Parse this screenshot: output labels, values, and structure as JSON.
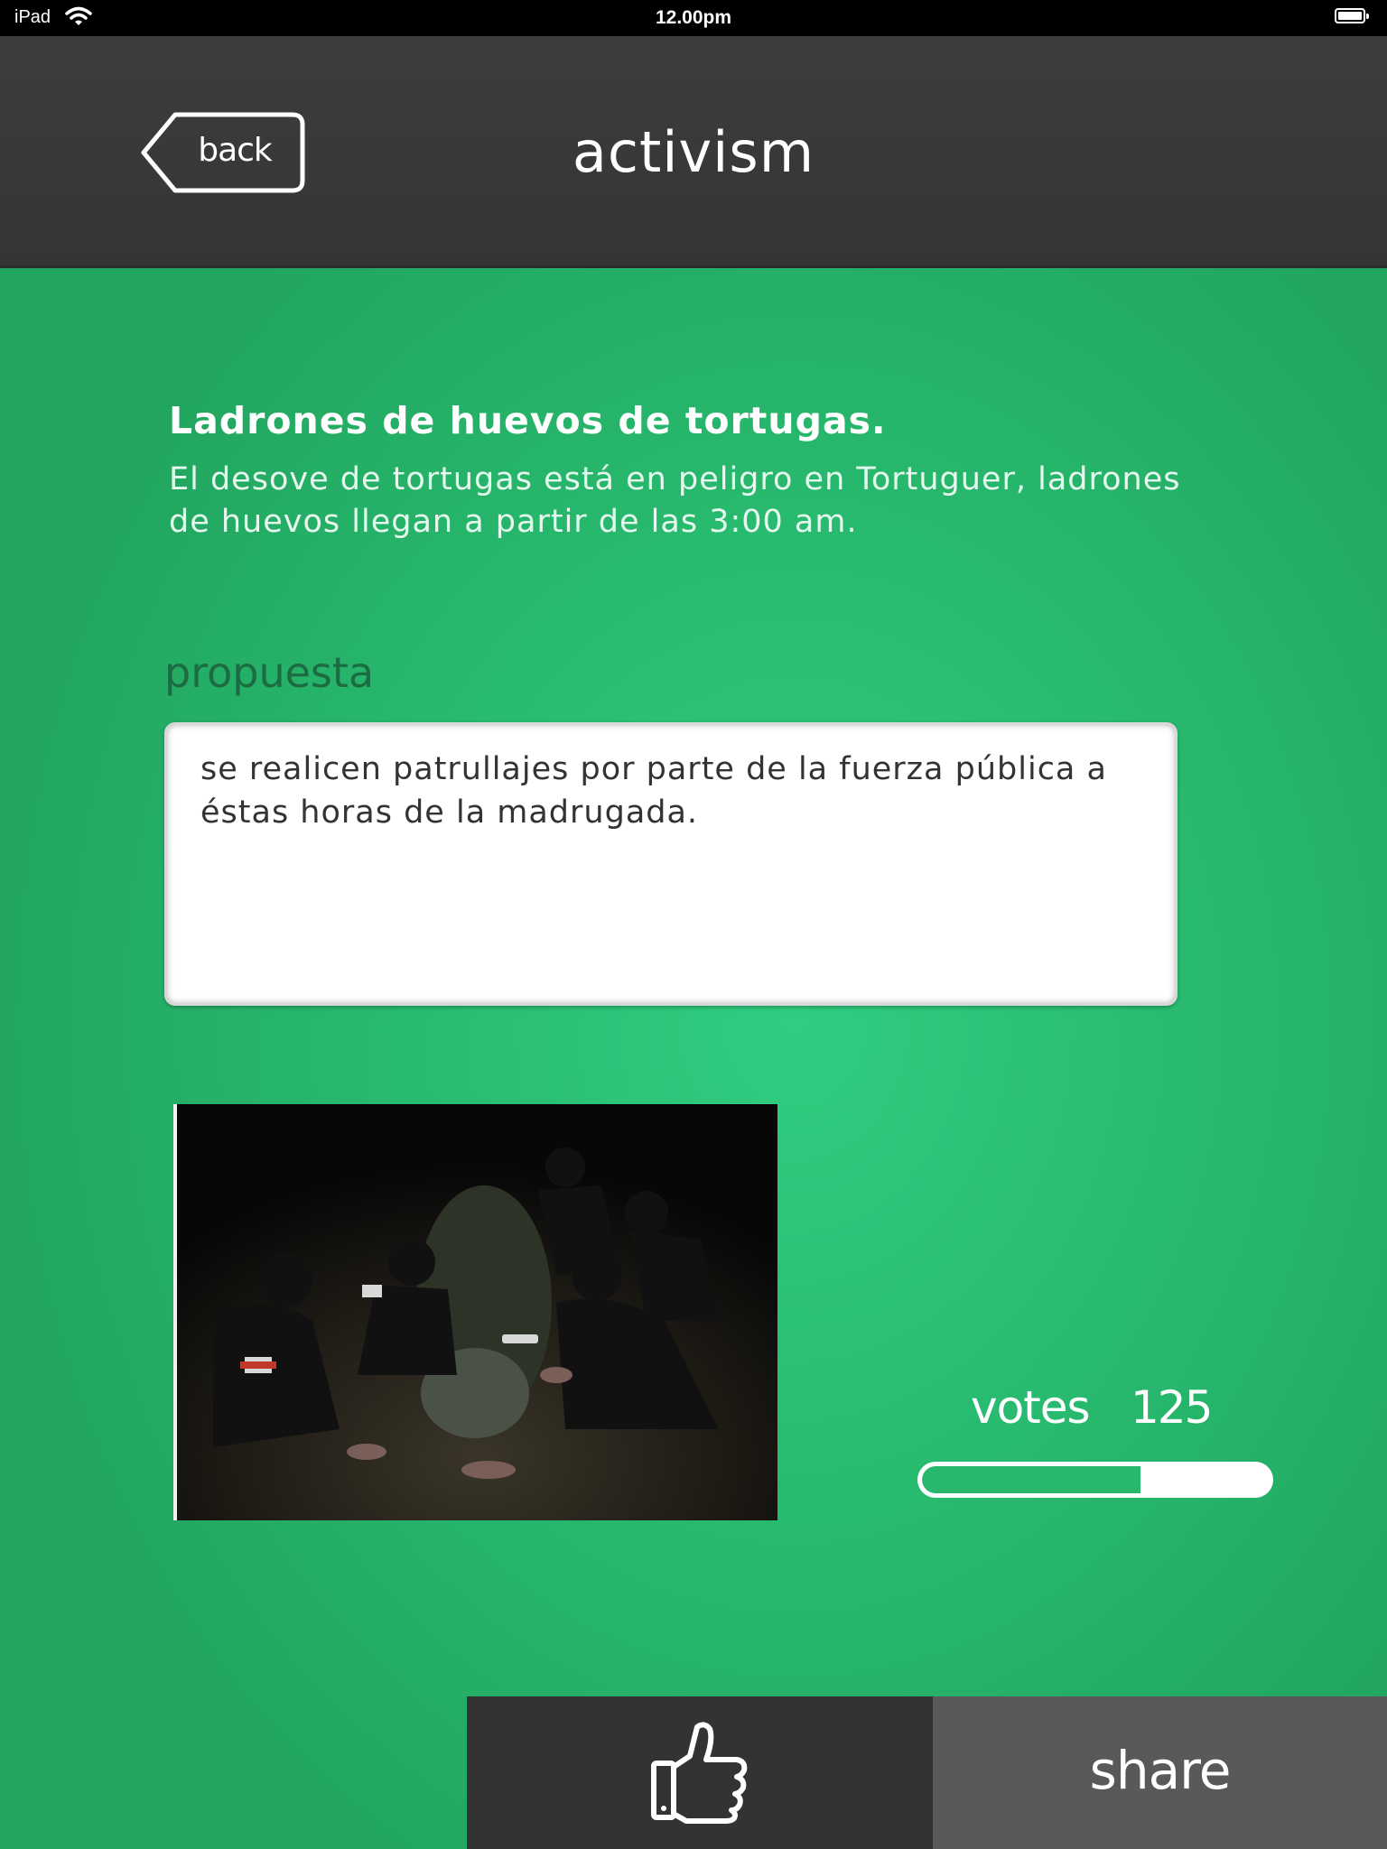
{
  "status_bar": {
    "device": "iPad",
    "time": "12.00pm"
  },
  "nav": {
    "back_label": "back",
    "title": "activism"
  },
  "issue": {
    "title": "Ladrones de huevos de tortugas.",
    "description": "El desove de tortugas está en peligro en Tortuguer, ladrones de huevos llegan a partir de las 3:00 am."
  },
  "proposal": {
    "heading": "propuesta",
    "text": "se realicen patrullajes por parte de la fuerza pública a éstas horas de la madrugada."
  },
  "votes": {
    "label": "votes",
    "count": "125",
    "progress_fraction": 0.63
  },
  "actions": {
    "like_icon": "thumbs-up-icon",
    "share_label": "share"
  },
  "colors": {
    "background_green": "#27b86d",
    "nav_dark": "#3a3b3b",
    "like_bg": "#333333",
    "share_bg": "#58595a"
  }
}
